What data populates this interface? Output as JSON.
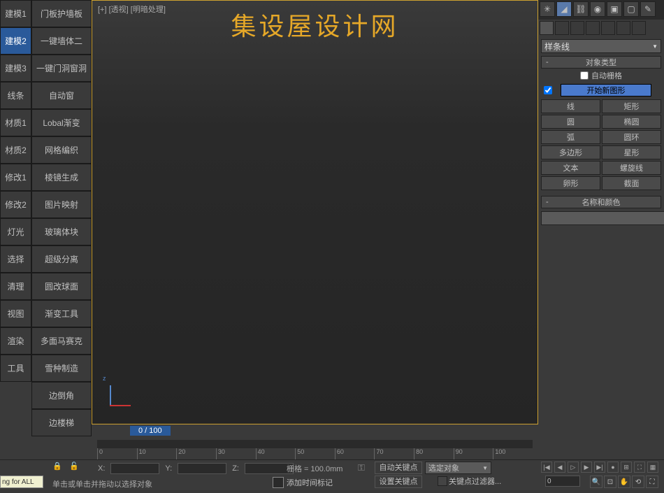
{
  "sidebar": {
    "col1": [
      "建模1",
      "建模2",
      "建模3",
      "线条",
      "材质1",
      "材质2",
      "修改1",
      "修改2",
      "灯光",
      "选择",
      "清理",
      "视图",
      "渲染",
      "工具"
    ],
    "col2": [
      "门板护墙板",
      "一键墙体二",
      "一键门洞窗洞",
      "自动窗",
      "Lobal渐变",
      "网格编织",
      "棱镜生成",
      "图片映射",
      "玻璃体块",
      "超级分离",
      "圆改球面",
      "渐变工具",
      "多面马赛克",
      "雪种制造",
      "边倒角",
      "边楼梯"
    ],
    "active_col1_index": 1
  },
  "viewport": {
    "label": "[+] [透视] [明暗处理]",
    "watermark": "集设屋设计网"
  },
  "timeline": {
    "frame": "0 / 100",
    "ticks": [
      "0",
      "10",
      "20",
      "30",
      "40",
      "50",
      "60",
      "70",
      "80",
      "90",
      "100"
    ]
  },
  "right": {
    "dropdown": "样条线",
    "rollout1": "对象类型",
    "auto_grid": "自动栅格",
    "start_shape": "开始新图形",
    "shapes": [
      "线",
      "矩形",
      "圆",
      "椭圆",
      "弧",
      "圆环",
      "多边形",
      "星形",
      "文本",
      "螺旋线",
      "卵形",
      "截面"
    ],
    "rollout2": "名称和颜色"
  },
  "bottom": {
    "x": "X:",
    "y": "Y:",
    "z": "Z:",
    "grid": "栅格 = 100.0mm",
    "hint": "单击或单击并拖动以选择对象",
    "time_tag": "添加时间标记",
    "auto_key": "自动关键点",
    "set_key": "设置关键点",
    "sel_obj": "选定对象",
    "key_filter": "关键点过滤器...",
    "frame_val": "0",
    "tiny": "ng for ALL"
  }
}
